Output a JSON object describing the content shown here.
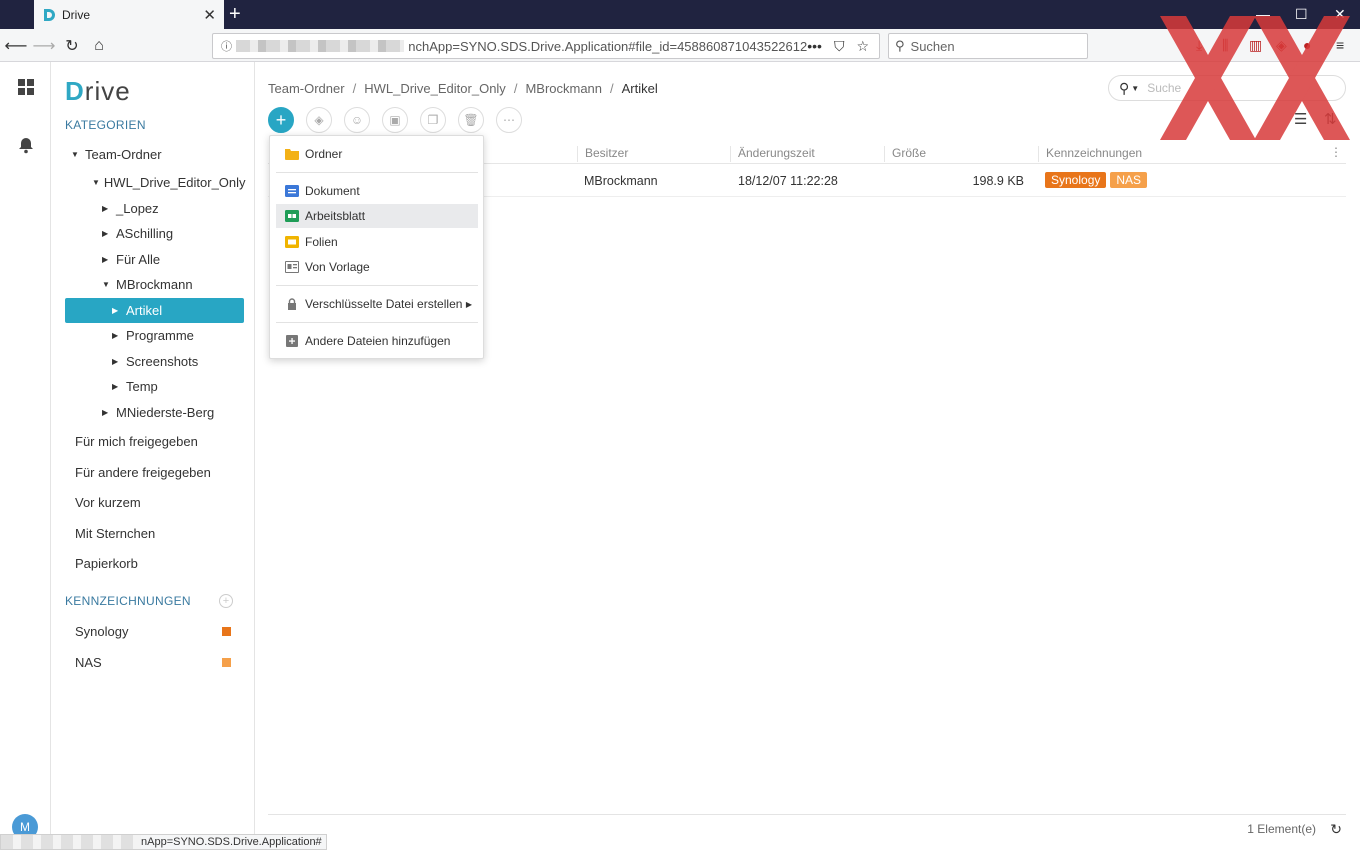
{
  "browser": {
    "tab_title": "Drive",
    "url_suffix": "nchApp=SYNO.SDS.Drive.Application#file_id=458860871043522612",
    "search_placeholder": "Suchen",
    "status_url": "nApp=SYNO.SDS.Drive.Application#"
  },
  "rail": {
    "avatar_letter": "M"
  },
  "sidebar": {
    "logo_d": "D",
    "logo_rest": "rive",
    "categories_title": "KATEGORIEN",
    "tree": [
      {
        "label": "Team-Ordner"
      },
      {
        "label": "HWL_Drive_Editor_Only"
      },
      {
        "label": "_Lopez"
      },
      {
        "label": "ASchilling"
      },
      {
        "label": "Für Alle"
      },
      {
        "label": "MBrockmann"
      },
      {
        "label": "Artikel"
      },
      {
        "label": "Programme"
      },
      {
        "label": "Screenshots"
      },
      {
        "label": "Temp"
      },
      {
        "label": "MNiederste-Berg"
      }
    ],
    "links": [
      {
        "label": "Für mich freigegeben"
      },
      {
        "label": "Für andere freigegeben"
      },
      {
        "label": "Vor kurzem"
      },
      {
        "label": "Mit Sternchen"
      },
      {
        "label": "Papierkorb"
      }
    ],
    "tags_title": "KENNZEICHNUNGEN",
    "tags": [
      {
        "label": "Synology",
        "color": "#e8751a"
      },
      {
        "label": "NAS",
        "color": "#f5a04a"
      }
    ]
  },
  "main": {
    "breadcrumb": [
      "Team-Ordner",
      "HWL_Drive_Editor_Only",
      "MBrockmann",
      "Artikel"
    ],
    "search_placeholder": "Suche",
    "columns": [
      "Besitzer",
      "Änderungszeit",
      "Größe",
      "Kennzeichnungen"
    ],
    "rows": [
      {
        "owner": "MBrockmann",
        "modified": "18/12/07 11:22:28",
        "size": "198.9 KB",
        "tags": [
          "Synology",
          "NAS"
        ]
      }
    ],
    "footer_count": "1 Element(e)"
  },
  "menu": {
    "items": [
      {
        "label": "Ordner",
        "icon": "folder-icon",
        "color": "#f3b117"
      },
      {
        "label": "Dokument",
        "icon": "document-icon",
        "color": "#3b78d8"
      },
      {
        "label": "Arbeitsblatt",
        "icon": "spreadsheet-icon",
        "color": "#1f9d57"
      },
      {
        "label": "Folien",
        "icon": "slides-icon",
        "color": "#f0b400"
      },
      {
        "label": "Von Vorlage",
        "icon": "template-icon",
        "color": "#777777"
      },
      {
        "label": "Verschlüsselte Datei erstellen",
        "icon": "lock-icon",
        "color": "#777777"
      },
      {
        "label": "Andere Dateien hinzufügen",
        "icon": "add-file-icon",
        "color": "#777777"
      }
    ]
  }
}
